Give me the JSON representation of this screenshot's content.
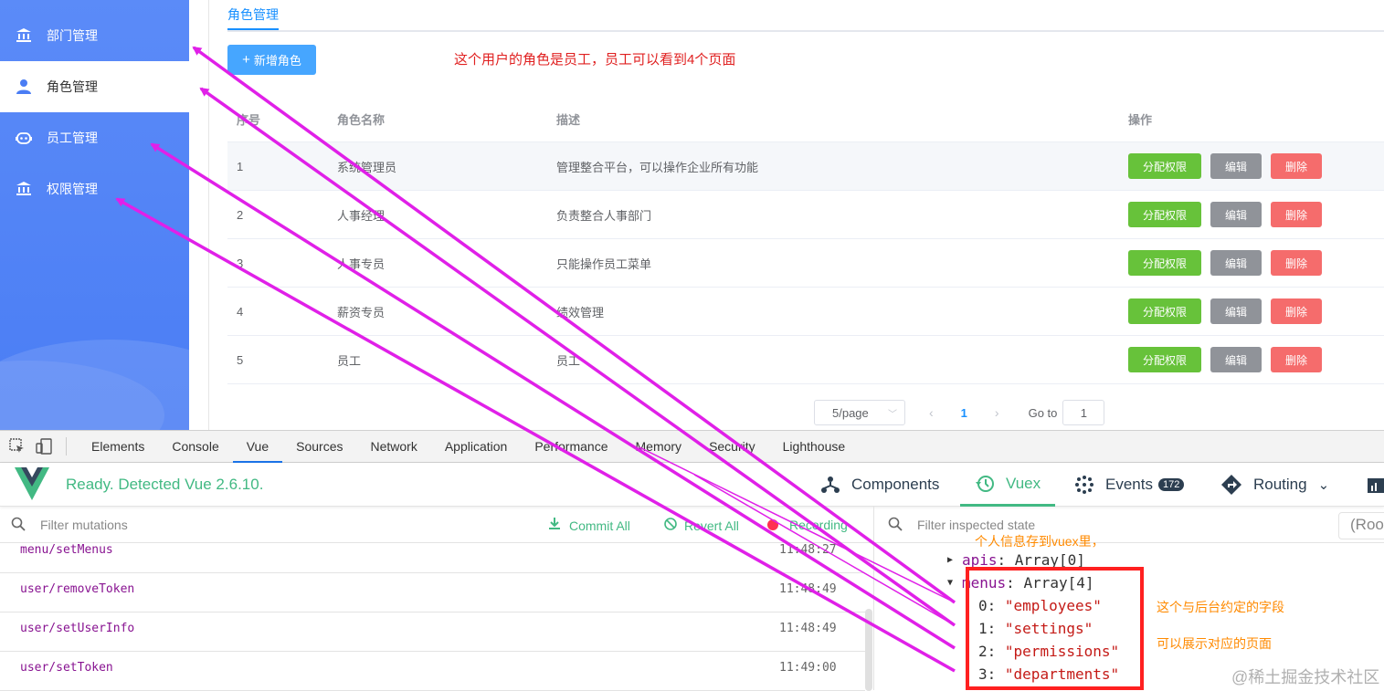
{
  "sidebar": {
    "items": [
      {
        "label": "部门管理",
        "icon": "bank-icon",
        "active": false
      },
      {
        "label": "角色管理",
        "icon": "user-icon",
        "active": true
      },
      {
        "label": "员工管理",
        "icon": "robot-icon",
        "active": false
      },
      {
        "label": "权限管理",
        "icon": "bank-icon",
        "active": false
      }
    ]
  },
  "main": {
    "tab": "角色管理",
    "add_button": "新增角色",
    "annotation": "这个用户的角色是员工，员工可以看到4个页面",
    "table": {
      "headers": [
        "序号",
        "角色名称",
        "描述",
        "操作"
      ],
      "rows": [
        {
          "index": "1",
          "name": "系统管理员",
          "desc": "管理整合平台，可以操作企业所有功能"
        },
        {
          "index": "2",
          "name": "人事经理",
          "desc": "负责整合人事部门"
        },
        {
          "index": "3",
          "name": "人事专员",
          "desc": "只能操作员工菜单"
        },
        {
          "index": "4",
          "name": "薪资专员",
          "desc": "绩效管理"
        },
        {
          "index": "5",
          "name": "员工",
          "desc": "员工"
        }
      ],
      "actions": {
        "assign": "分配权限",
        "edit": "编辑",
        "delete": "删除"
      }
    },
    "pagination": {
      "page_size": "5/page",
      "current_page": "1",
      "goto_label": "Go to",
      "goto_value": "1"
    }
  },
  "devtools": {
    "tabs": [
      "Elements",
      "Console",
      "Vue",
      "Sources",
      "Network",
      "Application",
      "Performance",
      "Memory",
      "Security",
      "Lighthouse"
    ],
    "active_tab": "Vue",
    "vue": {
      "ready_text": "Ready. Detected Vue 2.6.10.",
      "components_tab": "Components",
      "vuex_tab": "Vuex",
      "events_tab": "Events",
      "events_count": "172",
      "routing_tab": "Routing",
      "filter_mutations_placeholder": "Filter mutations",
      "commit_all": "Commit All",
      "revert_all": "Revert All",
      "recording": "Recording",
      "mutations": [
        {
          "name": "menu/setMenus",
          "time": "11:48:27"
        },
        {
          "name": "user/removeToken",
          "time": "11:48:49"
        },
        {
          "name": "user/setUserInfo",
          "time": "11:48:49"
        },
        {
          "name": "user/setToken",
          "time": "11:49:00"
        }
      ],
      "filter_state_placeholder": "Filter inspected state",
      "root_selector": "(Roo",
      "state": {
        "apis_key": "apis",
        "apis_value": "Array[0]",
        "menus_key": "menus",
        "menus_value": "Array[4]",
        "menus_items": [
          {
            "idx": "0:",
            "val": "\"employees\""
          },
          {
            "idx": "1:",
            "val": "\"settings\""
          },
          {
            "idx": "2:",
            "val": "\"permissions\""
          },
          {
            "idx": "3:",
            "val": "\"departments\""
          }
        ]
      }
    },
    "notes": {
      "vuex": "个人信息存到vuex里，",
      "fields": "这个与后台约定的字段",
      "pages": "可以展示对应的页面"
    }
  },
  "watermark": "@稀土掘金技术社区",
  "colors": {
    "sidebar": "#4a7df4",
    "primary": "#1890ff",
    "success": "#67c23a",
    "danger": "#f56c6c",
    "vue_green": "#42b983",
    "annotation_red": "#e02020",
    "arrow_magenta": "#e020e8"
  }
}
